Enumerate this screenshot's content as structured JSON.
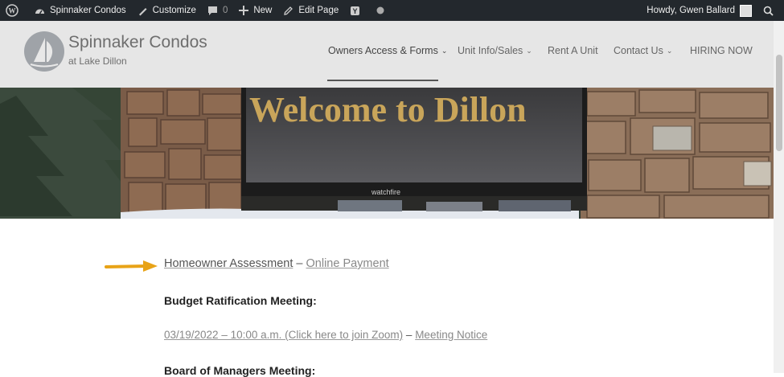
{
  "admin_bar": {
    "site_name": "Spinnaker Condos",
    "customize": "Customize",
    "comments_count": "0",
    "new": "New",
    "edit_page": "Edit Page",
    "greeting": "Howdy, Gwen Ballard"
  },
  "header": {
    "title": "Spinnaker Condos",
    "subtitle": "at Lake Dillon",
    "nav": [
      {
        "label": "Owners Access & Forms",
        "active": true,
        "dropdown": true
      },
      {
        "label": "Unit Info/Sales",
        "dropdown": true
      },
      {
        "label": "Rent A Unit",
        "dropdown": false
      },
      {
        "label": "Contact Us",
        "dropdown": true
      },
      {
        "label": "HIRING NOW",
        "dropdown": false
      }
    ]
  },
  "hero": {
    "sign_text": "Welcome to Dillon",
    "sign_brand": "watchfire"
  },
  "content": {
    "assessment_link": "Homeowner Assessment",
    "assessment_sep": " – ",
    "online_payment_link": "Online Payment",
    "budget_heading": "Budget Ratification Meeting:",
    "meeting_link": "03/19/2022 – 10:00 a.m. (Click here to join Zoom)",
    "meeting_sep": " – ",
    "meeting_notice_link": "Meeting Notice",
    "board_heading": "Board of Managers Meeting:"
  },
  "colors": {
    "admin_bar_bg": "#23282d",
    "header_bg": "#e6e6e6",
    "arrow": "#e8a317"
  }
}
